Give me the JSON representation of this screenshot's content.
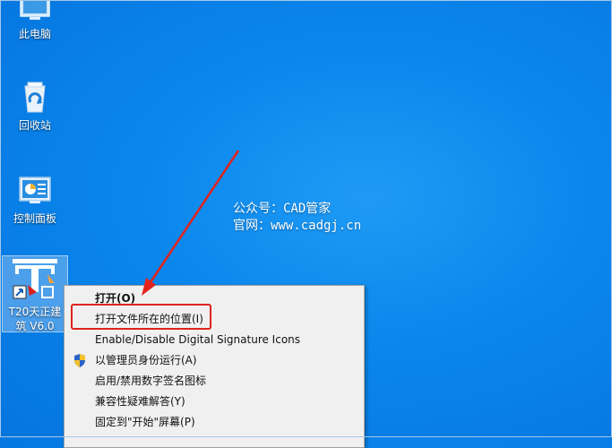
{
  "desktop": {
    "icons": [
      {
        "label": "此电脑",
        "icon": "computer-icon"
      },
      {
        "label": "回收站",
        "icon": "recycle-bin-icon"
      },
      {
        "label": "控制面板",
        "icon": "control-panel-icon"
      },
      {
        "label": "T20天正建筑 V6.0",
        "icon": "t20-app-icon"
      }
    ]
  },
  "watermark": {
    "line1": "公众号：CAD管家",
    "line2": "官网：www.cadgj.cn"
  },
  "context_menu": {
    "items": [
      {
        "label": "打开(O)"
      },
      {
        "label": "打开文件所在的位置(I)"
      },
      {
        "label": "Enable/Disable Digital Signature Icons"
      },
      {
        "label": "以管理员身份运行(A)",
        "icon": "uac-shield-icon"
      },
      {
        "label": "启用/禁用数字签名图标"
      },
      {
        "label": "兼容性疑难解答(Y)"
      },
      {
        "label": "固定到\"开始\"屏幕(P)"
      }
    ]
  },
  "colors": {
    "desktop_blue": "#0a86ec",
    "annotation_red": "#e0241c",
    "menu_bg": "#f0f0f0"
  }
}
